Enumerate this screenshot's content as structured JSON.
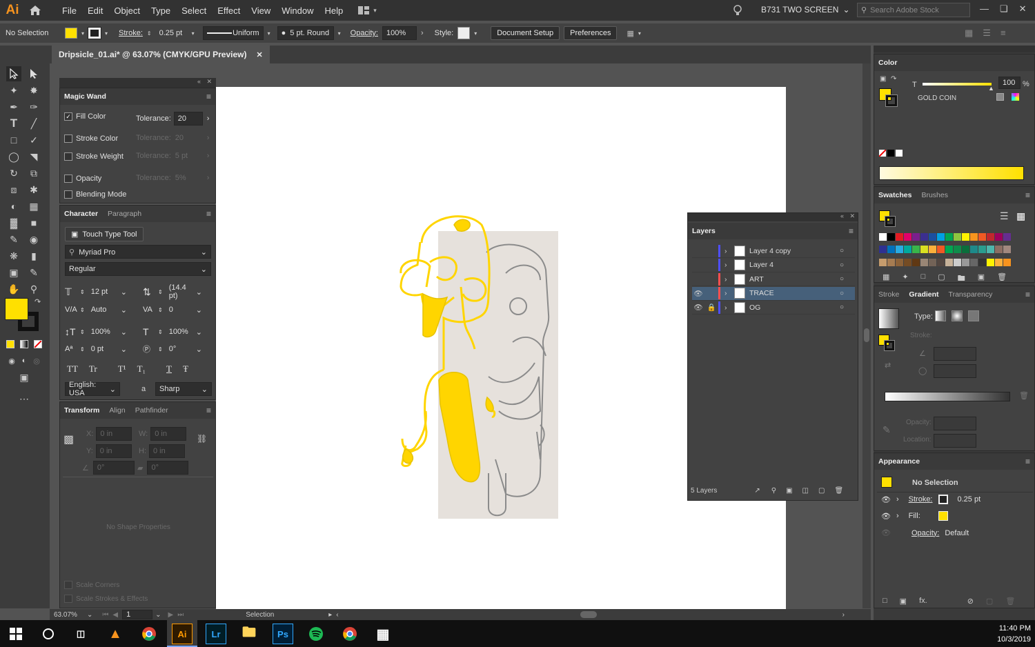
{
  "app": {
    "logo": "Ai"
  },
  "menu": [
    "File",
    "Edit",
    "Object",
    "Type",
    "Select",
    "Effect",
    "View",
    "Window",
    "Help"
  ],
  "workspace": {
    "name": "B731 TWO SCREEN",
    "search_placeholder": "Search Adobe Stock"
  },
  "control": {
    "selection_status": "No Selection",
    "stroke_label": "Stroke:",
    "stroke_value": "0.25 pt",
    "profile": "Uniform",
    "brush": "5 pt. Round",
    "opacity_label": "Opacity:",
    "opacity_value": "100%",
    "style_label": "Style:",
    "document_setup": "Document Setup",
    "preferences": "Preferences"
  },
  "document": {
    "tab_title": "Dripsicle_01.ai* @ 63.07% (CMYK/GPU Preview)"
  },
  "magic_wand": {
    "title": "Magic Wand",
    "fill_color": "Fill Color",
    "stroke_color": "Stroke Color",
    "stroke_weight": "Stroke Weight",
    "opacity": "Opacity",
    "blending_mode": "Blending Mode",
    "tolerance_label": "Tolerance:",
    "fill_tolerance": "20",
    "stroke_tolerance": "20",
    "weight_tolerance": "5 pt",
    "opacity_tolerance": "5%"
  },
  "character": {
    "tabs": [
      "Character",
      "Paragraph"
    ],
    "touch_type": "Touch Type Tool",
    "font_family": "Myriad Pro",
    "font_style": "Regular",
    "size": "12 pt",
    "leading": "(14.4 pt)",
    "kerning": "Auto",
    "tracking": "0",
    "vscale": "100%",
    "hscale": "100%",
    "baseline": "0 pt",
    "rotation": "0°",
    "language": "English: USA",
    "antialias": "Sharp",
    "aa_icon": "a",
    "type_buttons": [
      "TT",
      "Tr",
      "T¹",
      "T₁",
      "T",
      "Ŧ"
    ]
  },
  "transform": {
    "tabs": [
      "Transform",
      "Align",
      "Pathfinder"
    ],
    "x_label": "X:",
    "x_value": "0 in",
    "y_label": "Y:",
    "y_value": "0 in",
    "w_label": "W:",
    "w_value": "0 in",
    "h_label": "H:",
    "h_value": "0 in",
    "angle": "0°",
    "shear": "0°",
    "no_shape": "No Shape Properties",
    "scale_corners": "Scale Corners",
    "scale_strokes": "Scale Strokes & Effects"
  },
  "layers": {
    "title": "Layers",
    "rows": [
      {
        "name": "Layer 4 copy",
        "color": "#4f4fff",
        "visible": false,
        "locked": false,
        "selected": false
      },
      {
        "name": "Layer 4",
        "color": "#4f4fff",
        "visible": false,
        "locked": false,
        "selected": false
      },
      {
        "name": "ART",
        "color": "#ff4f4f",
        "visible": false,
        "locked": false,
        "selected": false
      },
      {
        "name": "TRACE",
        "color": "#ff4f4f",
        "visible": true,
        "locked": false,
        "selected": true
      },
      {
        "name": "OG",
        "color": "#4f4fff",
        "visible": true,
        "locked": true,
        "selected": false
      }
    ],
    "count": "5 Layers"
  },
  "color_panel": {
    "title": "Color",
    "channel": "T",
    "value": "100",
    "percent": "%",
    "name": "GOLD COIN",
    "fill": "#ffe000"
  },
  "swatches": {
    "tabs": [
      "Swatches",
      "Brushes"
    ]
  },
  "gradient": {
    "tabs": [
      "Stroke",
      "Gradient",
      "Transparency"
    ],
    "type_label": "Type:",
    "stroke_label": "Stroke:",
    "opacity_label": "Opacity:",
    "location_label": "Location:"
  },
  "appearance": {
    "title": "Appearance",
    "status": "No Selection",
    "stroke_label": "Stroke:",
    "stroke_value": "0.25 pt",
    "fill_label": "Fill:",
    "opacity_label": "Opacity:",
    "opacity_value": "Default"
  },
  "status": {
    "zoom": "63.07%",
    "artboard": "1",
    "tool": "Selection"
  },
  "taskbar": {
    "time": "11:40 PM",
    "date": "10/3/2019",
    "apps": [
      "Ai",
      "Lr",
      "Ps"
    ]
  }
}
